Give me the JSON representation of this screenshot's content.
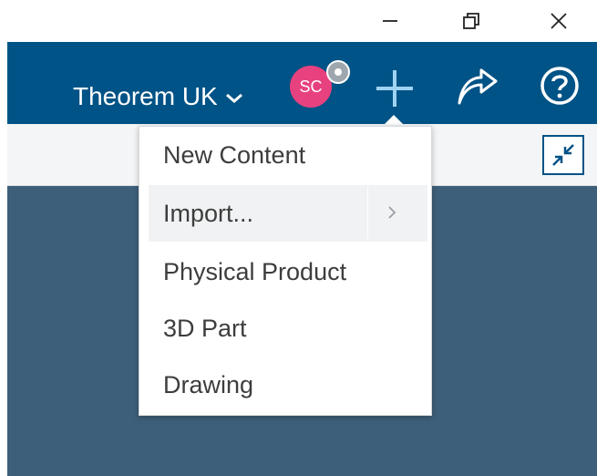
{
  "window": {
    "buttons": [
      {
        "name": "minimize",
        "icon": "minimize-icon"
      },
      {
        "name": "restore",
        "icon": "restore-icon"
      },
      {
        "name": "close",
        "icon": "close-icon"
      }
    ]
  },
  "header": {
    "tenant": "Theorem UK",
    "tenant_icon": "chevron-down-icon",
    "avatar_initials": "SC",
    "icons": [
      "plus-icon",
      "share-icon",
      "help-icon"
    ]
  },
  "toolbar": {
    "collapse_icon": "collapse-icon"
  },
  "menu": {
    "items": [
      {
        "label": "New Content",
        "has_submenu": false
      },
      {
        "label": "Import...",
        "has_submenu": true
      },
      {
        "label": "Physical Product",
        "has_submenu": false
      },
      {
        "label": "3D Part",
        "has_submenu": false
      },
      {
        "label": "Drawing",
        "has_submenu": false
      }
    ]
  },
  "colors": {
    "appbar": "#005386",
    "workarea": "#3d5f79",
    "avatar": "#e8417f",
    "menu_text": "#3d3d3d",
    "menu_hover": "#f1f2f3",
    "plus_icon": "#9fd3f2"
  }
}
